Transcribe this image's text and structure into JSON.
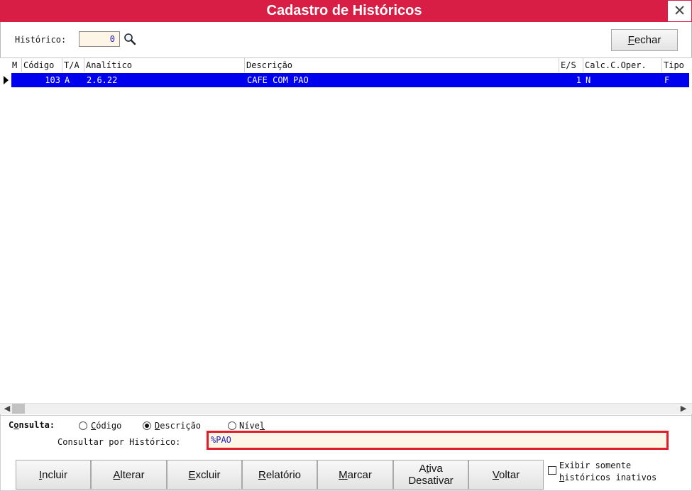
{
  "window": {
    "title": "Cadastro de Históricos",
    "close_glyph": "✕"
  },
  "toolbar": {
    "historico_label": "Histórico:",
    "historico_value": "0",
    "fechar_label": "Fechar"
  },
  "grid": {
    "columns": [
      "M",
      "Código",
      "T/A",
      "Analítico",
      "Descrição",
      "E/S",
      "Calc.C.Oper.",
      "Tipo"
    ],
    "rows": [
      {
        "m": "",
        "codigo": "103",
        "ta": "A",
        "analitico": "2.6.22",
        "descricao": "CAFE COM PAO",
        "es": "1",
        "calc": "N",
        "tipo": "F"
      }
    ],
    "selected_row": 0
  },
  "consulta": {
    "label": "Consulta:",
    "options": [
      "Código",
      "Descrição",
      "Nível"
    ],
    "selected": "Descrição",
    "query_label": "Consultar por Histórico:",
    "query_value": "%PAO"
  },
  "actions": [
    "Incluir",
    "Alterar",
    "Excluir",
    "Relatório",
    "Marcar",
    "Ativa",
    "Desativar",
    "Voltar"
  ],
  "inactive_checkbox": {
    "line1": "Exibir somente",
    "line2": "históricos inativos",
    "checked": false
  },
  "colors": {
    "title_bar": "#d81e44",
    "selection": "#0000ee",
    "highlight_border": "#e21d2a",
    "input_bg": "#fdf5e6"
  },
  "icons": {
    "search": "search-icon",
    "close": "close-icon",
    "row_pointer": "row-indicator-icon"
  }
}
